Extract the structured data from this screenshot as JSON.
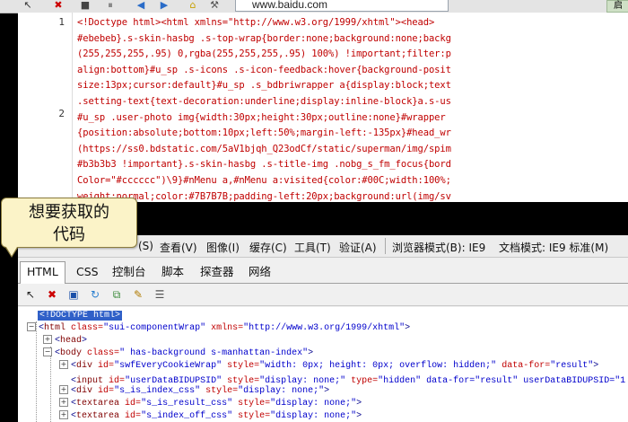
{
  "browser": {
    "url": "www.baidu.com",
    "top_right_btn": "启"
  },
  "source_view": {
    "line_numbers": [
      "1",
      "2"
    ],
    "lines": [
      "<!Doctype html><html xmlns=\"http://www.w3.org/1999/xhtml\"><head>",
      "#ebebeb}.s-skin-hasbg .s-top-wrap{border:none;background:none;backg",
      "(255,255,255,.95) 0,rgba(255,255,255,.95) 100%) !important;filter:p",
      "align:bottom}#u_sp .s-icons .s-icon-feedback:hover{background-posit",
      "size:13px;cursor:default}#u_sp .s_bdbriwrapper a{display:block;text",
      ".setting-text{text-decoration:underline;display:inline-block}a.s-us",
      "#u_sp .user-photo img{width:30px;height:30px;outline:none}#wrapper",
      "{position:absolute;bottom:10px;left:50%;margin-left:-135px}#head_wr",
      "(https://ss0.bdstatic.com/5aV1bjqh_Q23odCf/static/superman/img/spim",
      "#b3b3b3 !important}.s-skin-hasbg .s-title-img .nobg_s_fm_focus{bord",
      "Color=\"#cccccc\")\\9}#nMenu a,#nMenu a:visited{color:#00C;width:100%;",
      "weight:normal;color:#7B7B7B;padding-left:20px;background:url(img/sv"
    ]
  },
  "callout": {
    "line1": "想要获取的",
    "line2": "代码"
  },
  "devtools": {
    "menu": [
      "(S)",
      "查看(V)",
      "图像(I)",
      "缓存(C)",
      "工具(T)",
      "验证(A)",
      "浏览器模式(B): IE9",
      "文档模式: IE9 标准(M)"
    ],
    "tabs": [
      "HTML",
      "CSS",
      "控制台",
      "脚本",
      "探查器",
      "网络"
    ],
    "active_tab": "HTML",
    "tree": {
      "doctype": "<!DOCTYPE html>",
      "html_open": "html",
      "html_class_attr": "class=",
      "html_class_val": "\"sui-componentWrap\"",
      "html_xmlns_attr": "xmlns=",
      "html_xmlns_val": "\"http://www.w3.org/1999/xhtml\"",
      "head": "head",
      "body": "body",
      "body_class_attr": "class=",
      "body_class_val": "\" has-background s-manhattan-index\"",
      "rows": [
        {
          "tag": "div",
          "a1": "id=",
          "v1": "\"swfEveryCookieWrap\"",
          "a2": "style=",
          "v2": "\"width: 0px; height: 0px; overflow: hidden;\"",
          "a3": "data-for=",
          "v3": "\"result\""
        },
        {
          "tag": "input",
          "a1": "id=",
          "v1": "\"userDataBIDUPSID\"",
          "a2": "style=",
          "v2": "\"display: none;\"",
          "a3": "type=",
          "v3": "\"hidden\" data-for=\"result\" userDataBIDUPSID=\"1"
        },
        {
          "tag": "div",
          "a1": "id=",
          "v1": "\"s_is_index_css\"",
          "a2": "style=",
          "v2": "\"display: none;\"",
          "a3": "",
          "v3": ""
        },
        {
          "tag": "textarea",
          "a1": "id=",
          "v1": "\"s_is_result_css\"",
          "a2": "style=",
          "v2": "\"display: none;\"",
          "a3": "",
          "v3": ""
        },
        {
          "tag": "textarea",
          "a1": "id=",
          "v1": "\"s_index_off_css\"",
          "a2": "style=",
          "v2": "\"display: none;\"",
          "a3": "",
          "v3": ""
        }
      ]
    }
  }
}
